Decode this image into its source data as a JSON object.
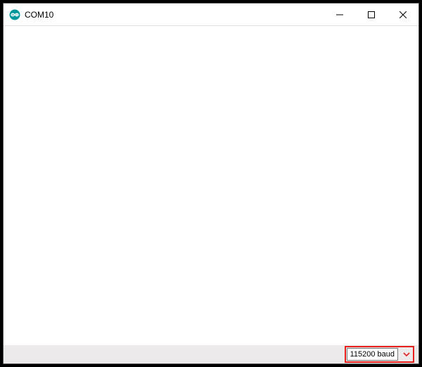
{
  "titlebar": {
    "title": "COM10"
  },
  "statusbar": {
    "baud_selected": "115200 baud"
  }
}
